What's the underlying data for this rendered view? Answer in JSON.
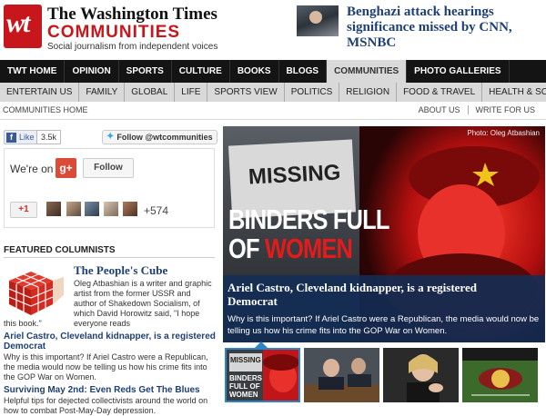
{
  "header": {
    "logo_mark": "wt",
    "brand_title": "The Washington Times",
    "brand_sub": "COMMUNITIES",
    "tagline": "Social journalism from independent voices",
    "promo_headline": "Benghazi attack hearings significance missed by CNN, MSNBC"
  },
  "main_nav": [
    "TWT HOME",
    "OPINION",
    "SPORTS",
    "CULTURE",
    "BOOKS",
    "BLOGS",
    "COMMUNITIES",
    "PHOTO GALLERIES"
  ],
  "main_nav_active": "COMMUNITIES",
  "sub_nav": [
    "ENTERTAIN US",
    "FAMILY",
    "GLOBAL",
    "LIFE",
    "SPORTS VIEW",
    "POLITICS",
    "RELIGION",
    "FOOD & TRAVEL",
    "HEALTH & SCIEN"
  ],
  "crumb": {
    "home": "COMMUNITIES HOME",
    "about": "ABOUT US",
    "write": "WRITE FOR US"
  },
  "social": {
    "fb_like": "Like",
    "fb_count": "3.5k",
    "twitter_follow": "Follow @wtcommunities",
    "were_on": "We're on",
    "gplus_mark": "g+",
    "follow": "Follow",
    "plus_one": "+1",
    "plus_count": "+574"
  },
  "featured": {
    "heading": "FEATURED COLUMNISTS",
    "columnist_name": "The People's Cube",
    "bio": "Oleg Atbashian is a writer and graphic artist from the former USSR and author of Shakedown Socialism, of which David Horowitz said, \"I hope everyone reads",
    "bio_end": "this book.\"",
    "stories": [
      {
        "title": "Ariel Castro, Cleveland kidnapper, is a registered Democrat",
        "text": "Why is this important? If Ariel Castro were a Republican, the media would now be telling us how his crime fits into the GOP War on Women."
      },
      {
        "title": "Surviving May 2nd: Even Reds Get The Blues",
        "text": "Helpful tips for dejected collectivists around the world on how to combat Post-May-Day depression."
      }
    ]
  },
  "hero": {
    "credit": "Photo: Oleg Atbashian",
    "sign_text": "MISSING",
    "binders": "BINDERS FULL",
    "of": "OF",
    "women": "WOMEN",
    "title": "Ariel Castro, Cleveland kidnapper, is a registered Democrat",
    "text": "Why is this important? If Ariel Castro were a Republican, the media would now be telling us how his crime fits into the GOP War on Women."
  },
  "thumbs": {
    "first_sign": "MISSING",
    "first_binders": "BINDERS FULL OF WOMEN"
  },
  "colors": {
    "brand_red": "#c8161d",
    "nav_dark": "#141414",
    "link_blue": "#1e3f73",
    "caption_blue": "#122e56",
    "active_thumb": "#2b84c6"
  }
}
